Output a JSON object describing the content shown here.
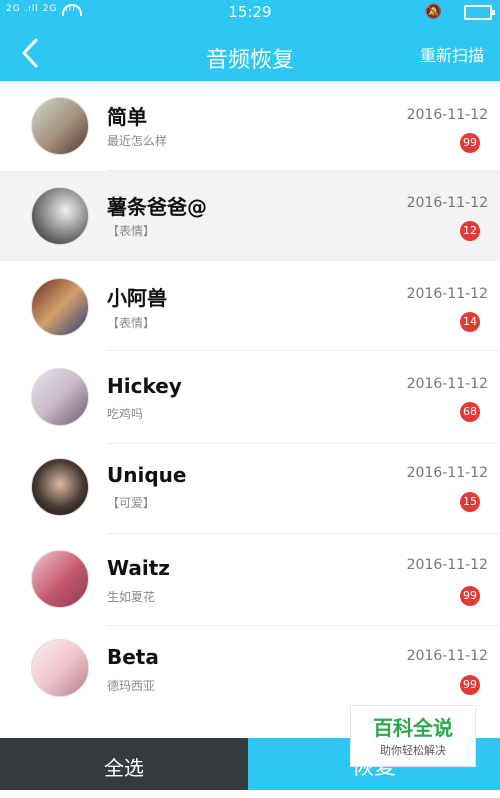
{
  "status": {
    "left_icons": "2G .ıll 2G .ıll",
    "time": "15:29"
  },
  "header": {
    "title": "音频恢复",
    "rescan": "重新扫描"
  },
  "rows": [
    {
      "name": "简单",
      "sub": "最近怎么样",
      "date": "2016-11-12",
      "count": "99",
      "selected": false
    },
    {
      "name": "薯条爸爸@",
      "sub": "【表情】",
      "date": "2016-11-12",
      "count": "12",
      "selected": true
    },
    {
      "name": "小阿兽",
      "sub": "【表情】",
      "date": "2016-11-12",
      "count": "14",
      "selected": false
    },
    {
      "name": "Hickey",
      "sub": "吃鸡吗",
      "date": "2016-11-12",
      "count": "68",
      "selected": false
    },
    {
      "name": "Unique",
      "sub": "【可爱】",
      "date": "2016-11-12",
      "count": "15",
      "selected": false
    },
    {
      "name": "Waitz",
      "sub": "生如夏花",
      "date": "2016-11-12",
      "count": "99",
      "selected": false
    },
    {
      "name": "Beta",
      "sub": "德玛西亚",
      "date": "2016-11-12",
      "count": "99",
      "selected": false
    }
  ],
  "bottom": {
    "select_all": "全选",
    "restore": "恢复"
  },
  "watermark": {
    "big": "百科全说",
    "small": "助你轻松解决"
  },
  "colors": {
    "accent": "#2ec6f2",
    "badge": "#e53935",
    "dark": "#363b40"
  }
}
